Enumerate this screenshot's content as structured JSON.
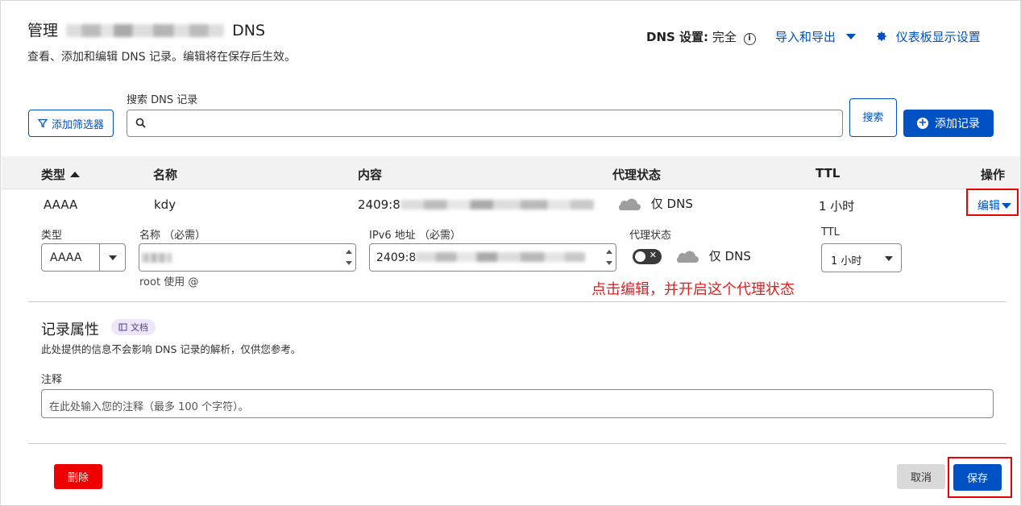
{
  "header": {
    "title_prefix": "管理",
    "title_suffix": "DNS",
    "subtitle": "查看、添加和编辑 DNS 记录。编辑将在保存后生效。",
    "dns_setting_label": "DNS 设置:",
    "dns_setting_value": "完全",
    "import_export_label": "导入和导出",
    "dashboard_settings_label": "仪表板显示设置"
  },
  "toolbar": {
    "filter_button": "添加筛选器",
    "search_label": "搜索 DNS 记录",
    "search_value": "",
    "search_button": "搜索",
    "add_record_button": "添加记录"
  },
  "table": {
    "columns": [
      "类型",
      "名称",
      "内容",
      "代理状态",
      "TTL",
      "操作"
    ],
    "rows": [
      {
        "type": "AAAA",
        "name": "kdy",
        "content": "2409:8",
        "proxy": "仅 DNS",
        "ttl": "1 小时",
        "action": "编辑"
      }
    ]
  },
  "edit_form": {
    "type_label": "类型",
    "type_value": "AAAA",
    "name_label": "名称 （必需）",
    "name_value": "",
    "name_hint": "root 使用 @",
    "ipv6_label": "IPv6 地址 （必需）",
    "ipv6_value": "2409:8",
    "proxy_label": "代理状态",
    "proxy_value": "仅 DNS",
    "proxy_enabled": false,
    "ttl_label": "TTL",
    "ttl_value": "1 小时"
  },
  "annotation": "点击编辑，并开启这个代理状态",
  "record_attributes": {
    "title": "记录属性",
    "doc_badge": "文档",
    "description": "此处提供的信息不会影响 DNS 记录的解析，仅供您参考。",
    "note_label": "注释",
    "note_placeholder": "在此处输入您的注释（最多 100 个字符）。"
  },
  "footer": {
    "delete_button": "删除",
    "cancel_button": "取消",
    "save_button": "保存"
  },
  "colors": {
    "accent": "#0051c3",
    "danger": "#e00000",
    "annotation": "#e02020"
  }
}
